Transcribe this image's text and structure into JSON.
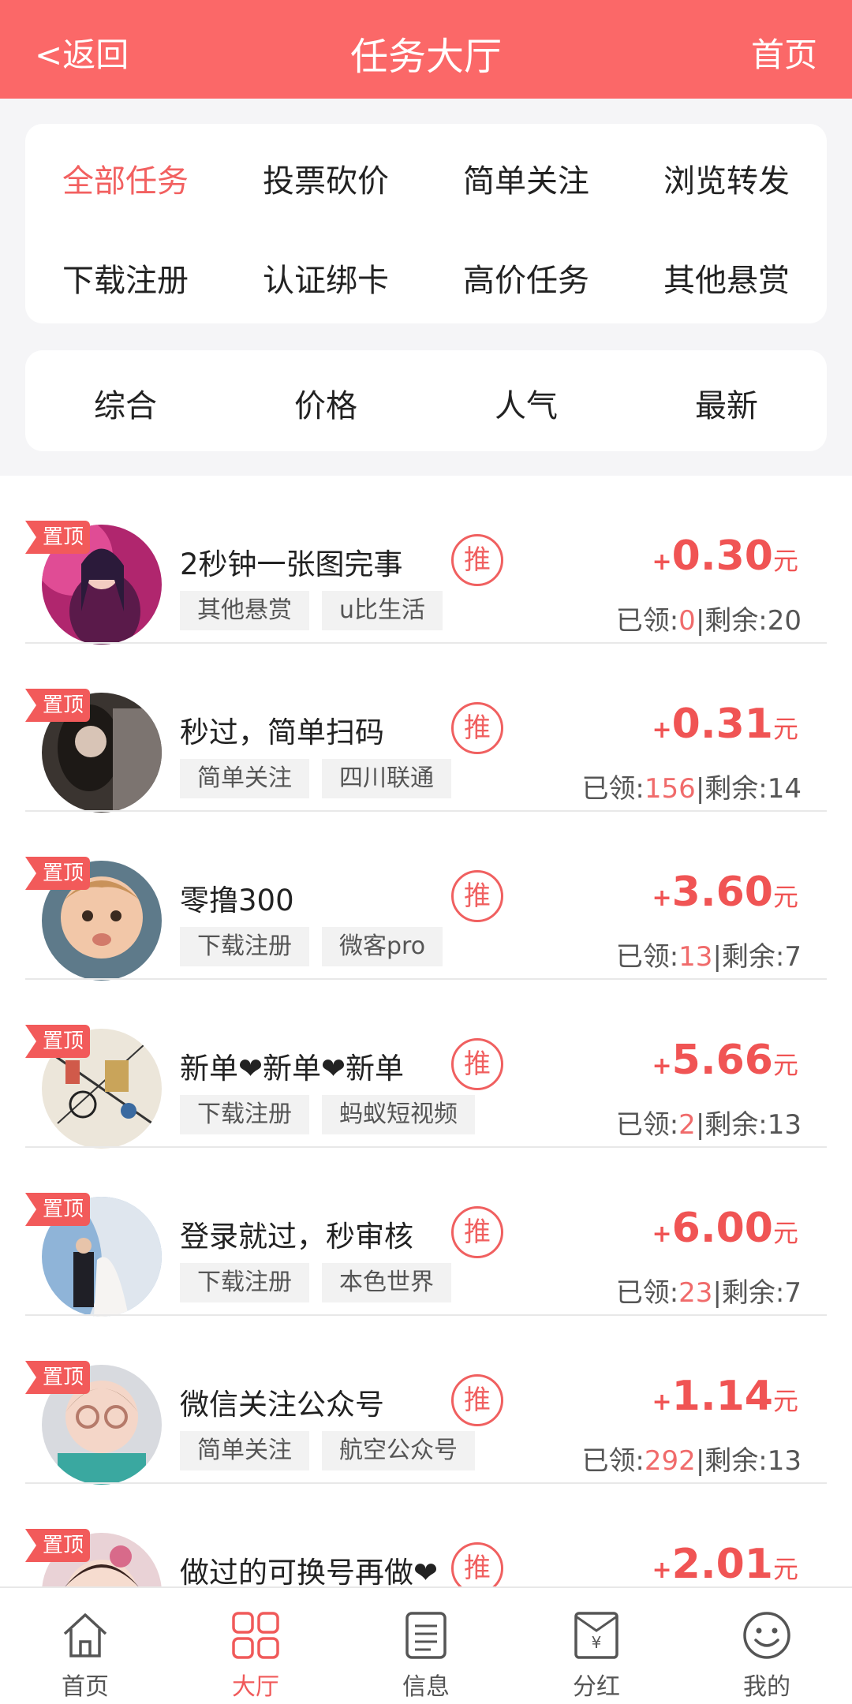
{
  "header": {
    "back": "<返回",
    "title": "任务大厅",
    "home": "首页"
  },
  "categories": [
    "全部任务",
    "投票砍价",
    "简单关注",
    "浏览转发",
    "下载注册",
    "认证绑卡",
    "高价任务",
    "其他悬赏"
  ],
  "active_category": "全部任务",
  "sort": [
    "综合",
    "价格",
    "人气",
    "最新"
  ],
  "pin_label": "置顶",
  "recommend_label": "推",
  "price_prefix": "+",
  "price_unit": "元",
  "claimed_label": "已领:",
  "remaining_label": "|剩余:",
  "tasks": [
    {
      "title": "2秒钟一张图完事",
      "tags": [
        "其他悬赏",
        "u比生活"
      ],
      "price": "0.30",
      "claimed": "0",
      "remaining": "20"
    },
    {
      "title": "秒过，简单扫码",
      "tags": [
        "简单关注",
        "四川联通"
      ],
      "price": "0.31",
      "claimed": "156",
      "remaining": "14"
    },
    {
      "title": "零撸300",
      "tags": [
        "下载注册",
        "微客pro"
      ],
      "price": "3.60",
      "claimed": "13",
      "remaining": "7"
    },
    {
      "title": "新单❤新单❤新单",
      "tags": [
        "下载注册",
        "蚂蚁短视频"
      ],
      "price": "5.66",
      "claimed": "2",
      "remaining": "13"
    },
    {
      "title": "登录就过，秒审核",
      "tags": [
        "下载注册",
        "本色世界"
      ],
      "price": "6.00",
      "claimed": "23",
      "remaining": "7"
    },
    {
      "title": "微信关注公众号",
      "tags": [
        "简单关注",
        "航空公众号"
      ],
      "price": "1.14",
      "claimed": "292",
      "remaining": "13"
    },
    {
      "title": "做过的可换号再做❤",
      "tags": [],
      "price": "2.01",
      "claimed": "",
      "remaining": ""
    }
  ],
  "tabbar": [
    {
      "label": "首页",
      "icon": "home-icon"
    },
    {
      "label": "大厅",
      "icon": "grid-icon"
    },
    {
      "label": "信息",
      "icon": "document-icon"
    },
    {
      "label": "分红",
      "icon": "yen-envelope-icon"
    },
    {
      "label": "我的",
      "icon": "smiley-icon"
    }
  ],
  "active_tab": "大厅",
  "colors": {
    "accent": "#fb6868",
    "price": "#f05454",
    "background": "#f5f5f7"
  }
}
